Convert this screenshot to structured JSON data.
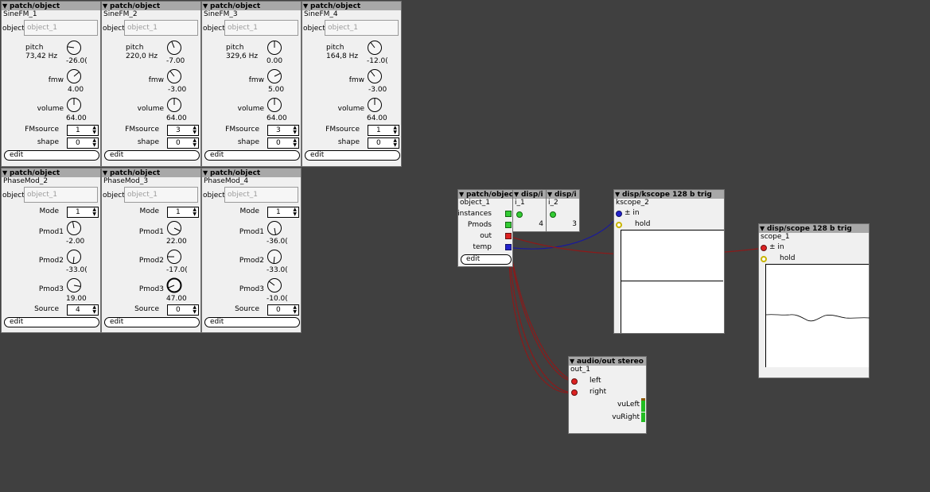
{
  "colors": {
    "canvas": "#404040",
    "header": "#a8a8a8",
    "audio_wire": "#8b1a1a",
    "int_wire": "#22aa22",
    "frac_wire": "#1a1a99"
  },
  "object_field_placeholder": "object_1",
  "edit_label": "edit",
  "sine": [
    {
      "title": "patch/object",
      "name": "SineFM_1",
      "obj": "object",
      "pitch_label": "pitch",
      "pitch_hz": "73,42 Hz",
      "pitch": "-26.0(",
      "fmw_label": "fmw",
      "fmw": "4.00",
      "volume_label": "volume",
      "volume": "64.00",
      "fmsrc_label": "FMsource",
      "fmsrc": "1",
      "shape_label": "shape",
      "shape": "0"
    },
    {
      "title": "patch/object",
      "name": "SineFM_2",
      "obj": "object",
      "pitch_label": "pitch",
      "pitch_hz": "220,0 Hz",
      "pitch": "-7.00",
      "fmw_label": "fmw",
      "fmw": "-3.00",
      "volume_label": "volume",
      "volume": "64.00",
      "fmsrc_label": "FMsource",
      "fmsrc": "3",
      "shape_label": "shape",
      "shape": "0"
    },
    {
      "title": "patch/object",
      "name": "SineFM_3",
      "obj": "object",
      "pitch_label": "pitch",
      "pitch_hz": "329,6 Hz",
      "pitch": "0.00",
      "fmw_label": "fmw",
      "fmw": "5.00",
      "volume_label": "volume",
      "volume": "64.00",
      "fmsrc_label": "FMsource",
      "fmsrc": "3",
      "shape_label": "shape",
      "shape": "0"
    },
    {
      "title": "patch/object",
      "name": "SineFM_4",
      "obj": "object",
      "pitch_label": "pitch",
      "pitch_hz": "164,8 Hz",
      "pitch": "-12.0(",
      "fmw_label": "fmw",
      "fmw": "-3.00",
      "volume_label": "volume",
      "volume": "64.00",
      "fmsrc_label": "FMsource",
      "fmsrc": "1",
      "shape_label": "shape",
      "shape": "0"
    }
  ],
  "phase": [
    {
      "title": "patch/object",
      "name": "PhaseMod_2",
      "obj": "object",
      "mode_label": "Mode",
      "mode": "1",
      "p1_label": "Pmod1",
      "p1": "-2.00",
      "p2_label": "Pmod2",
      "p2": "-33.0(",
      "p3_label": "Pmod3",
      "p3": "19.00",
      "src_label": "Source",
      "src": "4"
    },
    {
      "title": "patch/object",
      "name": "PhaseMod_3",
      "obj": "object",
      "mode_label": "Mode",
      "mode": "1",
      "p1_label": "Pmod1",
      "p1": "22.00",
      "p2_label": "Pmod2",
      "p2": "-17.0(",
      "p3_label": "Pmod3",
      "p3": "47.00",
      "src_label": "Source",
      "src": "0"
    },
    {
      "title": "patch/object",
      "name": "PhaseMod_4",
      "obj": "object",
      "mode_label": "Mode",
      "mode": "1",
      "p1_label": "Pmod1",
      "p1": "-36.0(",
      "p2_label": "Pmod2",
      "p2": "-33.0(",
      "p3_label": "Pmod3",
      "p3": "-10.0(",
      "src_label": "Source",
      "src": "0"
    }
  ],
  "main_obj": {
    "title": "patch/object",
    "name": "object_1",
    "instances": "instances",
    "pmods": "Pmods",
    "out": "out",
    "temp": "temp"
  },
  "disp1": {
    "title": "disp/i",
    "name": "i_1",
    "value": "4"
  },
  "disp2": {
    "title": "disp/i",
    "name": "i_2",
    "value": "3"
  },
  "kscope": {
    "title": "disp/kscope 128 b trig",
    "name": "kscope_2",
    "in": "± in",
    "hold": "hold"
  },
  "scope": {
    "title": "disp/scope 128 b trig",
    "name": "scope_1",
    "in": "± in",
    "hold": "hold"
  },
  "audioout": {
    "title": "audio/out stereo",
    "name": "out_1",
    "left": "left",
    "right": "right",
    "vuleft": "vuLeft",
    "vuright": "vuRight"
  }
}
